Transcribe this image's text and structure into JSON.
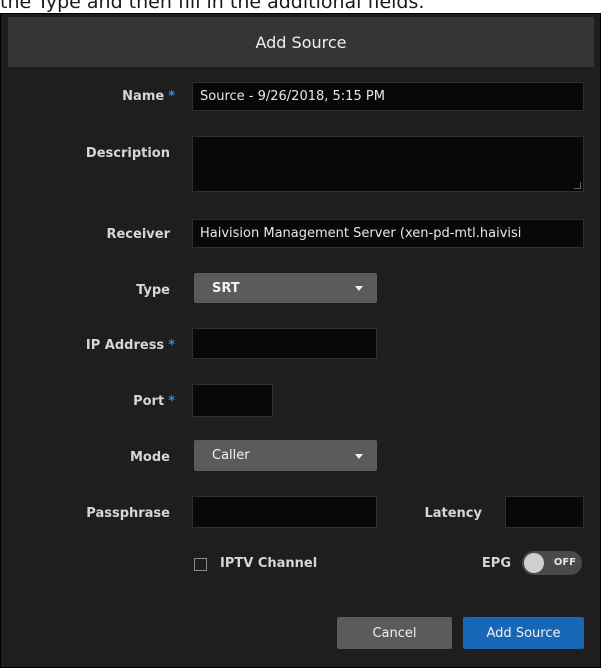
{
  "caption": {
    "text": "the Type and then fill in the additional fields."
  },
  "dialog": {
    "title": "Add Source",
    "fields": {
      "name": {
        "label": "Name",
        "required_mark": "*",
        "value": "Source - 9/26/2018, 5:15 PM"
      },
      "description": {
        "label": "Description",
        "value": ""
      },
      "receiver": {
        "label": "Receiver",
        "value": "Haivision Management Server (xen-pd-mtl.haivisi"
      },
      "type": {
        "label": "Type",
        "selected": "SRT"
      },
      "ip_address": {
        "label": "IP Address",
        "required_mark": "*",
        "value": ""
      },
      "port": {
        "label": "Port",
        "required_mark": "*",
        "value": ""
      },
      "mode": {
        "label": "Mode",
        "selected": "Caller"
      },
      "passphrase": {
        "label": "Passphrase",
        "value": ""
      },
      "latency": {
        "label": "Latency",
        "value": ""
      }
    },
    "iptv": {
      "label": "IPTV Channel",
      "checked": false
    },
    "epg": {
      "label": "EPG",
      "state": "OFF"
    },
    "buttons": {
      "cancel": "Cancel",
      "submit": "Add Source"
    }
  },
  "colors": {
    "dialog_bg": "#1e1e1e",
    "header_bg": "#353535",
    "required": "#2e8be6",
    "primary_button": "#1767b6"
  }
}
